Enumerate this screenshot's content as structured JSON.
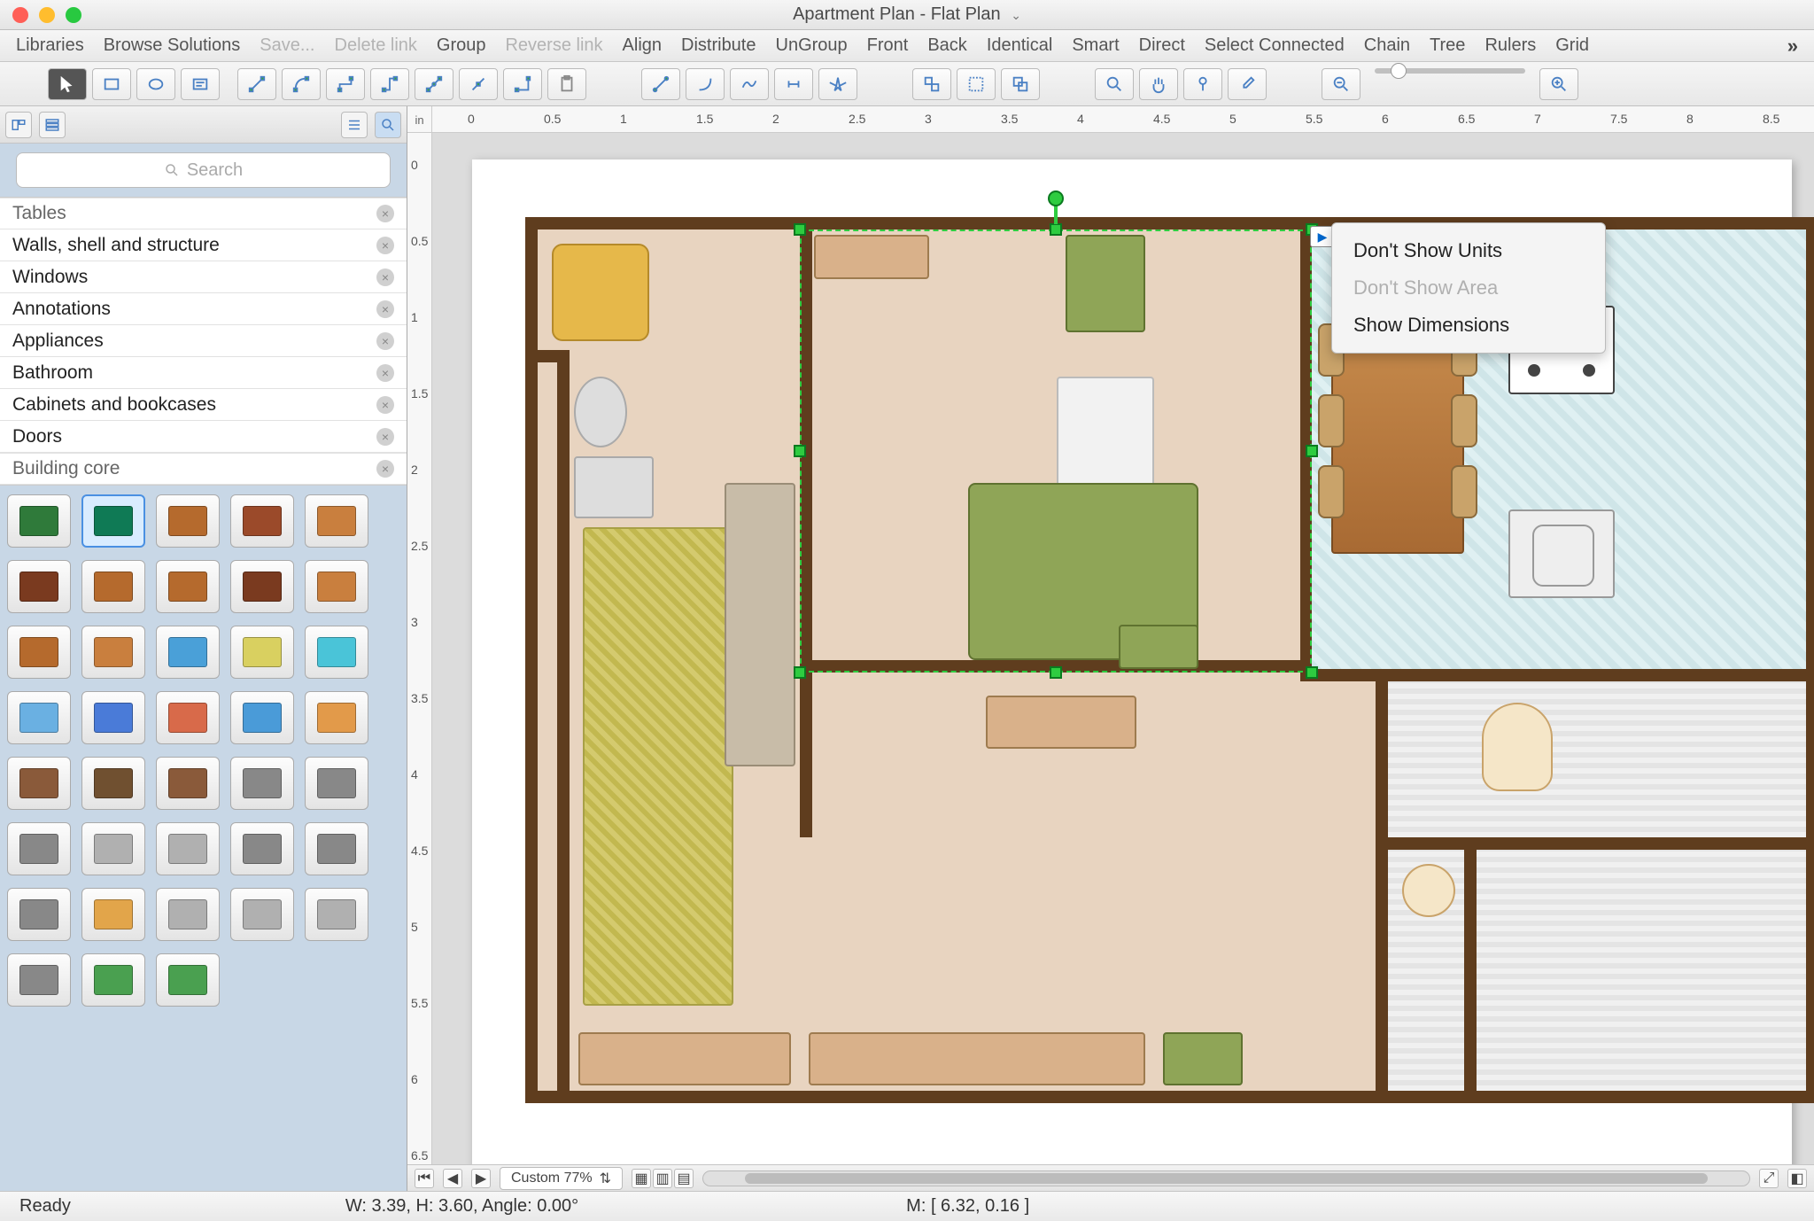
{
  "title": "Apartment Plan - Flat Plan",
  "menubar": [
    "Libraries",
    "Browse Solutions",
    "Save...",
    "Delete link",
    "Group",
    "Reverse link",
    "Align",
    "Distribute",
    "UnGroup",
    "Front",
    "Back",
    "Identical",
    "Smart",
    "Direct",
    "Select Connected",
    "Chain",
    "Tree",
    "Rulers",
    "Grid"
  ],
  "menubar_disabled": [
    2,
    3,
    5
  ],
  "sidebar": {
    "search_placeholder": "Search",
    "categories_top_cut": "Tables",
    "categories": [
      "Walls, shell and structure",
      "Windows",
      "Annotations",
      "Appliances",
      "Bathroom",
      "Cabinets and bookcases",
      "Doors"
    ],
    "categories_bottom_cut": "Building core",
    "shape_colors": [
      [
        "#2f7a3a",
        "#0f7a55",
        "#b56a2d",
        "#9b4a2a",
        "#c97f3e"
      ],
      [
        "#7a3a1f",
        "#b56a2d",
        "#b56a2d",
        "#7a3a1f",
        "#c97f3e"
      ],
      [
        "#b56a2d",
        "#c97f3e",
        "#4aa0d8",
        "#d9d060",
        "#4ac4d8"
      ],
      [
        "#6ab0e2",
        "#4a7bd8",
        "#d86a4a",
        "#4a9bd8",
        "#e29a4a"
      ],
      [
        "#8a5a3a",
        "#705030",
        "#8a5a3a",
        "#888888",
        "#888888"
      ],
      [
        "#888888",
        "#b0b0b0",
        "#b0b0b0",
        "#888888",
        "#888888"
      ],
      [
        "#888888",
        "#e2a54a",
        "#b0b0b0",
        "#b0b0b0",
        "#b0b0b0"
      ],
      [
        "#888888",
        "#4aa050",
        "#4aa050",
        "",
        ""
      ]
    ]
  },
  "ruler_unit": "in",
  "hruler": [
    "0",
    "0.5",
    "1",
    "1.5",
    "2",
    "2.5",
    "3",
    "3.5",
    "4",
    "4.5",
    "5",
    "5.5",
    "6",
    "6.5",
    "7",
    "7.5",
    "8",
    "8.5"
  ],
  "vruler": [
    "0",
    "0.5",
    "1",
    "1.5",
    "2",
    "2.5",
    "3",
    "3.5",
    "4",
    "4.5",
    "5",
    "5.5",
    "6",
    "6.5"
  ],
  "context_menu": [
    {
      "label": "Don't Show Units",
      "disabled": false
    },
    {
      "label": "Don't Show Area",
      "disabled": true
    },
    {
      "label": "Show Dimensions",
      "disabled": false
    }
  ],
  "bottombar": {
    "zoom": "Custom 77%"
  },
  "statusbar": {
    "ready": "Ready",
    "dims": "W: 3.39,  H: 3.60,  Angle: 0.00°",
    "mouse": "M: [ 6.32, 0.16 ]"
  }
}
